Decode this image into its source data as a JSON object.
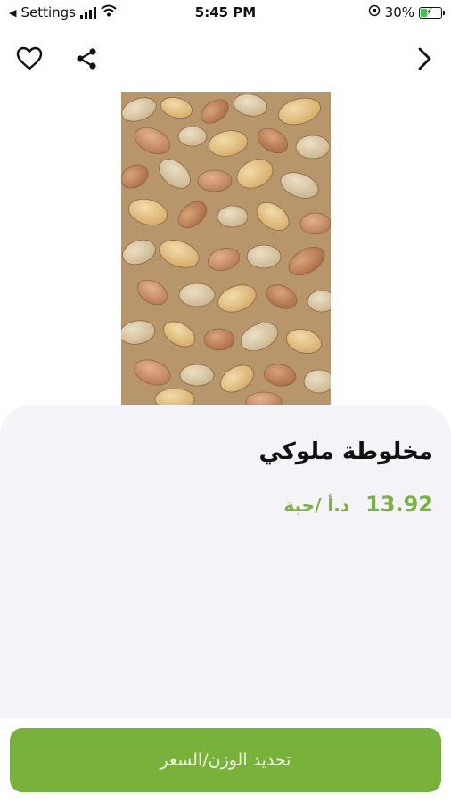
{
  "status_bar": {
    "back_app": "Settings",
    "time": "5:45 PM",
    "battery_percent": "30%"
  },
  "icons": {
    "favorite": "heart-outline-icon",
    "share": "share-icon",
    "next": "chevron-right-icon"
  },
  "product": {
    "image_alt": "mixed nuts",
    "name": "مخلوطة ملوكي",
    "price": "13.92",
    "price_unit": "د.أ /حبة"
  },
  "actions": {
    "select_weight_price": "تحديد الوزن/السعر"
  },
  "colors": {
    "accent_green": "#78b23a",
    "price_green": "#7ab33f",
    "sheet_bg": "#f3f3f8",
    "battery_green": "#3cc64b"
  }
}
